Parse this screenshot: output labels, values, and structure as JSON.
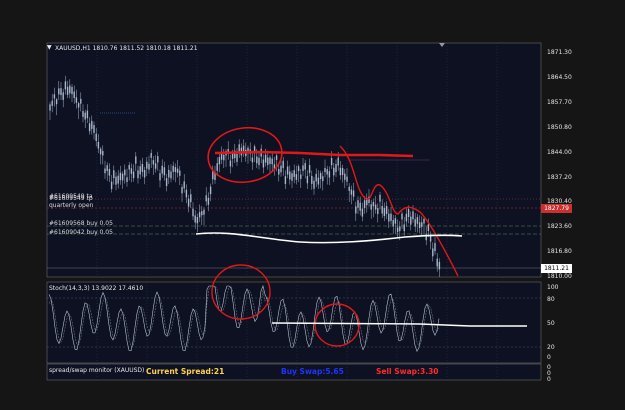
{
  "chart_header": {
    "arrow_icon": "triangle-down-icon",
    "symbol_info": "XAUUSD,H1  1810.76 1811.52 1810.18 1811.21"
  },
  "price_axis": {
    "ticks": [
      "1871.30",
      "1864.50",
      "1857.70",
      "1850.80",
      "1844.00",
      "1837.20",
      "1830.40",
      "1823.60",
      "1816.80",
      "1810.00"
    ],
    "current_price": "1811.21",
    "level_price": "1827.79"
  },
  "order_labels": {
    "line1a": "#61609549 ta",
    "line1b": "#61609549 tp",
    "line2": "quarterly open",
    "line3": "#61609568 buy 0.05",
    "line4": "#61609042 buy 0.05"
  },
  "stoch": {
    "title": "Stoch(14,3,3) 13.9022 17.4610",
    "ticks": [
      "100",
      "80",
      "50",
      "20",
      "0"
    ]
  },
  "spread_panel": {
    "title": "spread/swap monitor (XAUUSD)",
    "current_spread": "Current Spread:21",
    "buy_swap": "Buy Swap:5.65",
    "sell_swap": "Sell Swap:3.30",
    "ticks": [
      "0",
      "0",
      "0"
    ]
  },
  "colors": {
    "background": "#0d1122",
    "grid": "#2e3c5a",
    "candle": "#a9b8cc",
    "annotation_red": "#e01818",
    "annotation_white": "#ffffff",
    "current_spread": "#ffd24a",
    "buy_swap": "#2233ff",
    "sell_swap": "#ff2a2a"
  }
}
